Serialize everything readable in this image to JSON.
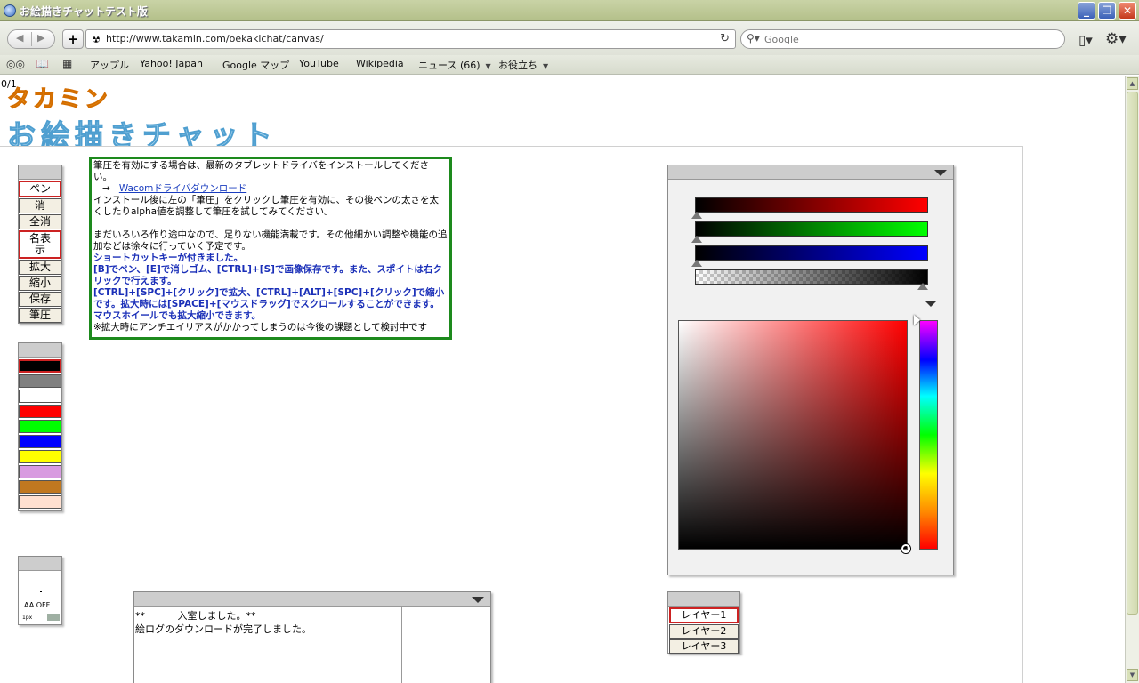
{
  "window": {
    "title": "お絵描きチャットテスト版"
  },
  "navbar": {
    "url": "http://www.takamin.com/oekakichat/canvas/",
    "search_placeholder": "Google"
  },
  "bookmarks": {
    "items": [
      {
        "label": "アップル"
      },
      {
        "label": "Yahoo! Japan"
      },
      {
        "label": "Google マップ"
      },
      {
        "label": "YouTube"
      },
      {
        "label": "Wikipedia"
      },
      {
        "label": "ニュース (66)"
      },
      {
        "label": "お役立ち"
      }
    ]
  },
  "page": {
    "counter": "0/1",
    "logo_brand": "タカミン",
    "logo_app": "お絵描きチャット"
  },
  "tools": {
    "buttons": [
      {
        "label": "ペン"
      },
      {
        "label": "消"
      },
      {
        "label": "全消"
      },
      {
        "label": "名表示"
      },
      {
        "label": "拡大"
      },
      {
        "label": "縮小"
      },
      {
        "label": "保存"
      },
      {
        "label": "筆圧"
      }
    ]
  },
  "palette": {
    "colors": [
      "#000000",
      "#808080",
      "#ffffff",
      "#ff0000",
      "#00ff00",
      "#0000ff",
      "#ffff00",
      "#d89ae0",
      "#c07820",
      "#ffe0d0"
    ]
  },
  "brush": {
    "aa_label": "AA OFF",
    "size_label": "1px"
  },
  "info": {
    "line1": "筆圧を有効にする場合は、最新のタブレットドライバをインストールしてください。",
    "arrow": "→",
    "link": "Wacomドライバダウンロード",
    "line2": "インストール後に左の「筆圧」をクリックし筆圧を有効に、その後ペンの太さを太くしたりalpha値を調整して筆圧を試してみてください。",
    "line3": "まだいろいろ作り途中なので、足りない機能満載です。その他細かい調整や機能の追加などは徐々に行っていく予定です。",
    "blue1": "ショートカットキーが付きました。",
    "blue2": "[B]でペン、[E]で消しゴム、[CTRL]+[S]で画像保存です。また、スポイトは右クリックで行えます。",
    "blue3": "[CTRL]+[SPC]+[クリック]で拡大、[CTRL]+[ALT]+[SPC]+[クリック]で縮小です。拡大時には[SPACE]+[マウスドラッグ]でスクロールすることができます。マウスホイールでも拡大縮小できます。",
    "line4": "※拡大時にアンチエイリアスがかかってしまうのは今後の課題として検討中です"
  },
  "chat": {
    "line1": "**　　　 入室しました。**",
    "line2": "絵ログのダウンロードが完了しました。"
  },
  "layers": {
    "items": [
      {
        "label": "レイヤー1"
      },
      {
        "label": "レイヤー2"
      },
      {
        "label": "レイヤー3"
      }
    ]
  }
}
